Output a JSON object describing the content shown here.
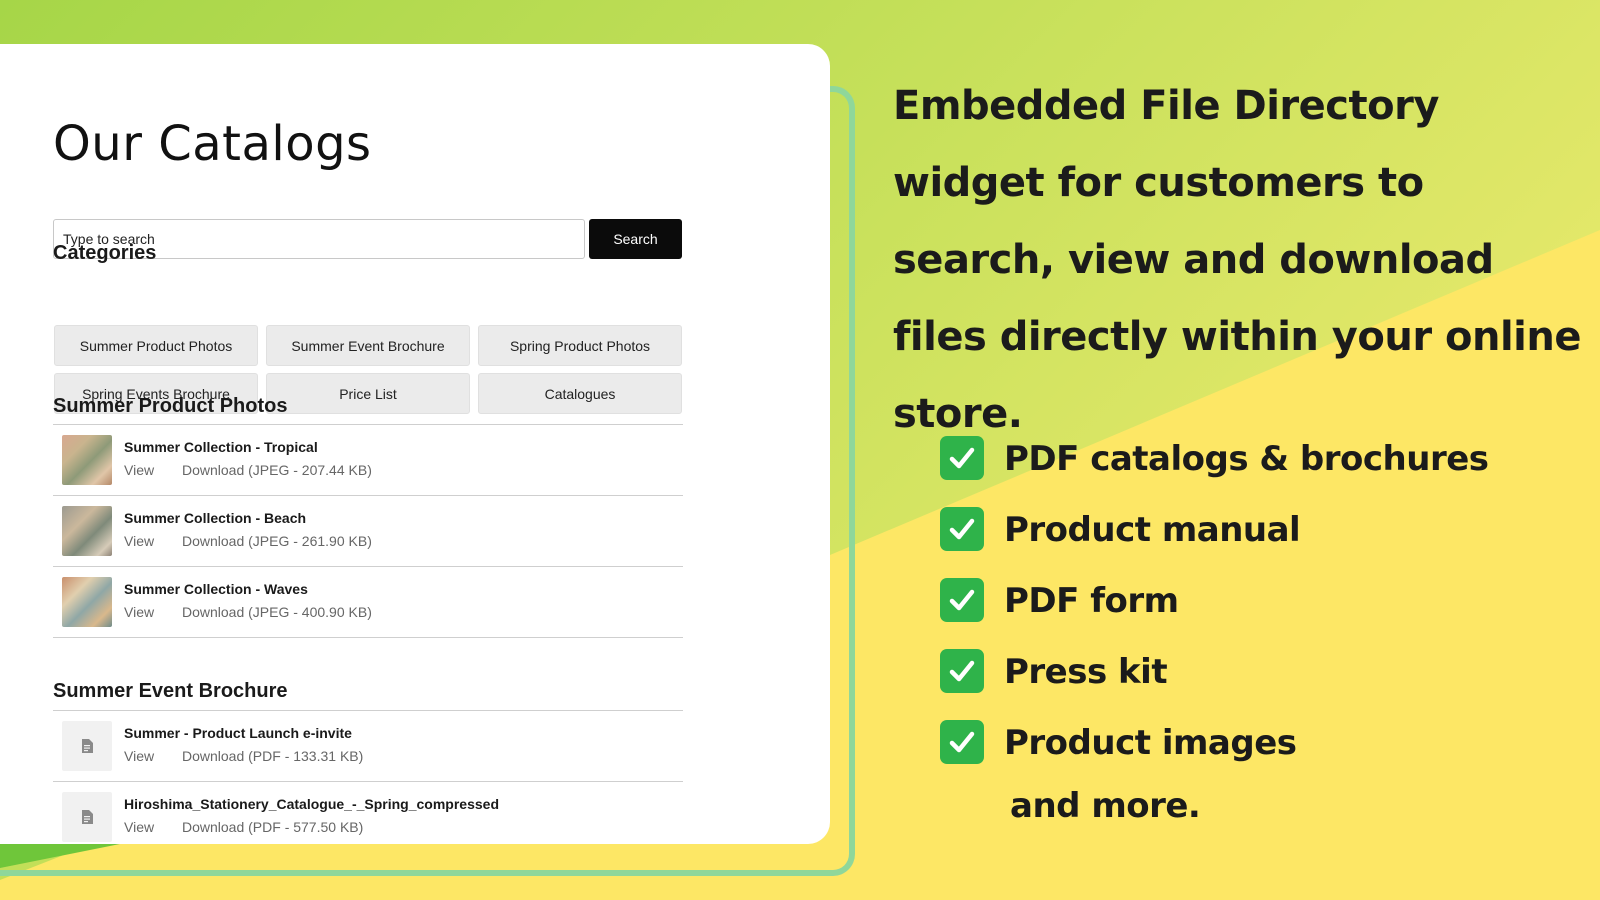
{
  "catalog": {
    "title": "Our Catalogs",
    "search": {
      "placeholder": "Type to search",
      "button_label": "Search"
    },
    "categories_heading": "Categories",
    "categories": [
      "Summer Product Photos",
      "Summer Event Brochure",
      "Spring Product Photos",
      "Spring Events Brochure",
      "Price List",
      "Catalogues"
    ],
    "sections": [
      {
        "heading": "Summer Product Photos",
        "files": [
          {
            "name": "Summer Collection - Tropical",
            "view": "View",
            "download": "Download (JPEG - 207.44 KB)",
            "thumb": "photo"
          },
          {
            "name": "Summer Collection - Beach",
            "view": "View",
            "download": "Download (JPEG - 261.90 KB)",
            "thumb": "photo"
          },
          {
            "name": "Summer Collection - Waves",
            "view": "View",
            "download": "Download (JPEG - 400.90 KB)",
            "thumb": "photo"
          }
        ]
      },
      {
        "heading": "Summer Event Brochure",
        "files": [
          {
            "name": "Summer - Product Launch e-invite",
            "view": "View",
            "download": "Download (PDF - 133.31 KB)",
            "thumb": "document-icon"
          },
          {
            "name": "Hiroshima_Stationery_Catalogue_-_Spring_compressed",
            "view": "View",
            "download": "Download (PDF - 577.50 KB)",
            "thumb": "document-icon"
          }
        ]
      }
    ]
  },
  "promo": {
    "heading": "Embedded File Directory widget for customers to search, view and download files directly within your online store.",
    "features": [
      "PDF catalogs & brochures",
      "Product manual",
      "PDF form",
      "Press kit",
      "Product images"
    ],
    "more": "and more.",
    "check_icon": "check-mark-button-icon"
  },
  "colors": {
    "accent_green": "#2fb34a",
    "frame_green": "#8fd79a",
    "background_yellow": "#fde765",
    "background_green": "#a6d648",
    "search_button": "#0b0b0b"
  }
}
